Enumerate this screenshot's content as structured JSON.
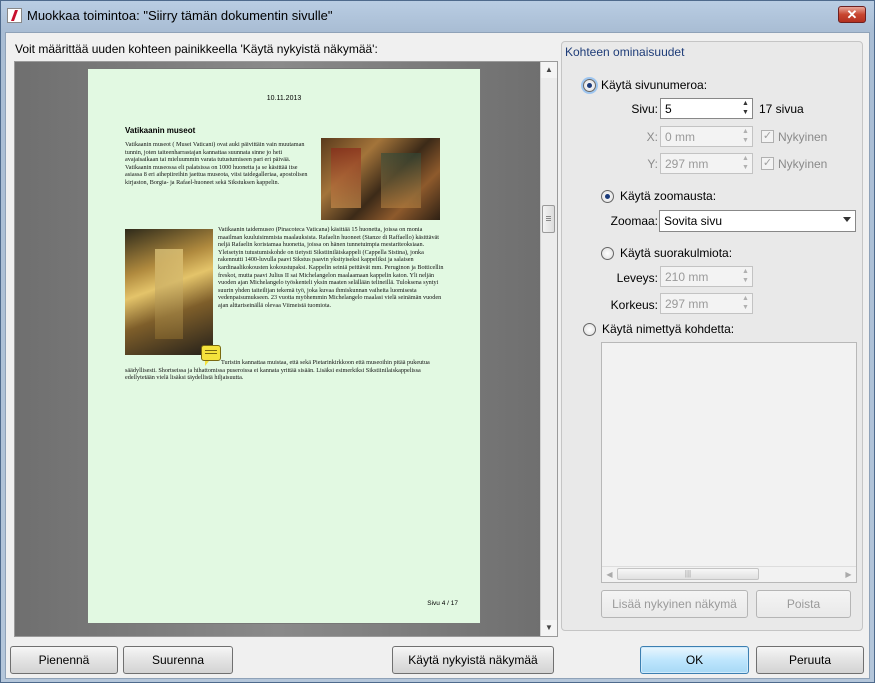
{
  "window": {
    "title": "Muokkaa toimintoa: \"Siirry tämän dokumentin sivulle\"",
    "close_glyph": "✕"
  },
  "instructions": "Voit määrittää uuden kohteen painikkeella 'Käytä nykyistä näkymää':",
  "preview": {
    "date": "10.11.2013",
    "title": "Vatikaanin museot",
    "para1": "Vatikaanin museot ( Musei Vaticani) ovat auki päivittäin vain muutaman tunnin, joten taiteenharrastajan kannattaa suunnata sinne jo heti avajaisaikaan tai mieluummin varata tutustumiseen pari eri päivää. Vatikaanin museossa eli palatsissa on 1000 huonetta ja se käsittää itse asiassa 8 eri aihepiireihin jaettua museota, viisi taidegalleriaa, apostolisen kirjaston, Borgia- ja Rafael-huoneet sekä Sikstuksen kappelin.",
    "para2": "Vatikaanin taidemuseo (Pinacoteca Vaticana) käsittää 15 huonetta, joissa on monia maailman kuuluisimmista maalauksista. Rafaelin huoneet (Stanze di Raffaello) käsittävät neljä Rafaelin koristamaa huonetta, joissa on hänen tunnetuimpia mestariteoksiaan. Yleisetyin tutustumiskohde on tietysti Sikstiiniläiskappeli (Cappella Sistina), jonka rakennutti 1400-luvulla paavi Sikstus paavin yksityiseksi kappeliksi ja salaisen kardinaalikokousten kokoustupaksi. Kappelin seiniä peittävät mm. Peruginon ja Botticellin freskot, mutta paavi Julius II sai Michelangelon maalaamaan kappelin katon. Yli neljän vuoden ajan Michelangelo työskenteli yksin maaten selällään telineillä. Tuloksena syntyi suurin yhden taiteilijan tekemä työ, joka kuvaa ihmiskunnan vaiheita luomisesta vedenpaisumukseen. 23 vuotta myöhemmin Michelangelo maalasi vielä seinämän vuoden ajan alttariseinällä olevaa Viimeistä tuomiota.",
    "para3": "Turistin kannattaa muistaa, että sekä Pietarinkirkkoon että museoihin pitää pukeutua säädyllisesti. Shortseissa ja hihattomissa puseroissa ei kannata yrittää sisään. Lisäksi esimerkiksi Sikstiinilaiskappelissa edellytetään vielä lisäksi täydellistä hiljaisuutta.",
    "footer": "Sivu 4 / 17"
  },
  "props": {
    "title": "Kohteen ominaisuudet",
    "use_page_label": "Käytä sivunumeroa:",
    "page_label": "Sivu:",
    "page_value": "5",
    "page_total": "17 sivua",
    "x_label": "X:",
    "x_value": "0 mm",
    "y_label": "Y:",
    "y_value": "297 mm",
    "current_label": "Nykyinen",
    "use_zoom_label": "Käytä zoomausta:",
    "zoom_label": "Zoomaa:",
    "zoom_value": "Sovita sivu",
    "use_rect_label": "Käytä suorakulmiota:",
    "width_label": "Leveys:",
    "width_value": "210 mm",
    "height_label": "Korkeus:",
    "height_value": "297 mm",
    "use_named_label": "Käytä nimettyä kohdetta:",
    "add_view_label": "Lisää nykyinen näkymä",
    "delete_label": "Poista"
  },
  "buttons": {
    "zoom_out": "Pienennä",
    "zoom_in": "Suurenna",
    "use_current": "Käytä nykyistä näkymää",
    "ok": "OK",
    "cancel": "Peruuta"
  }
}
